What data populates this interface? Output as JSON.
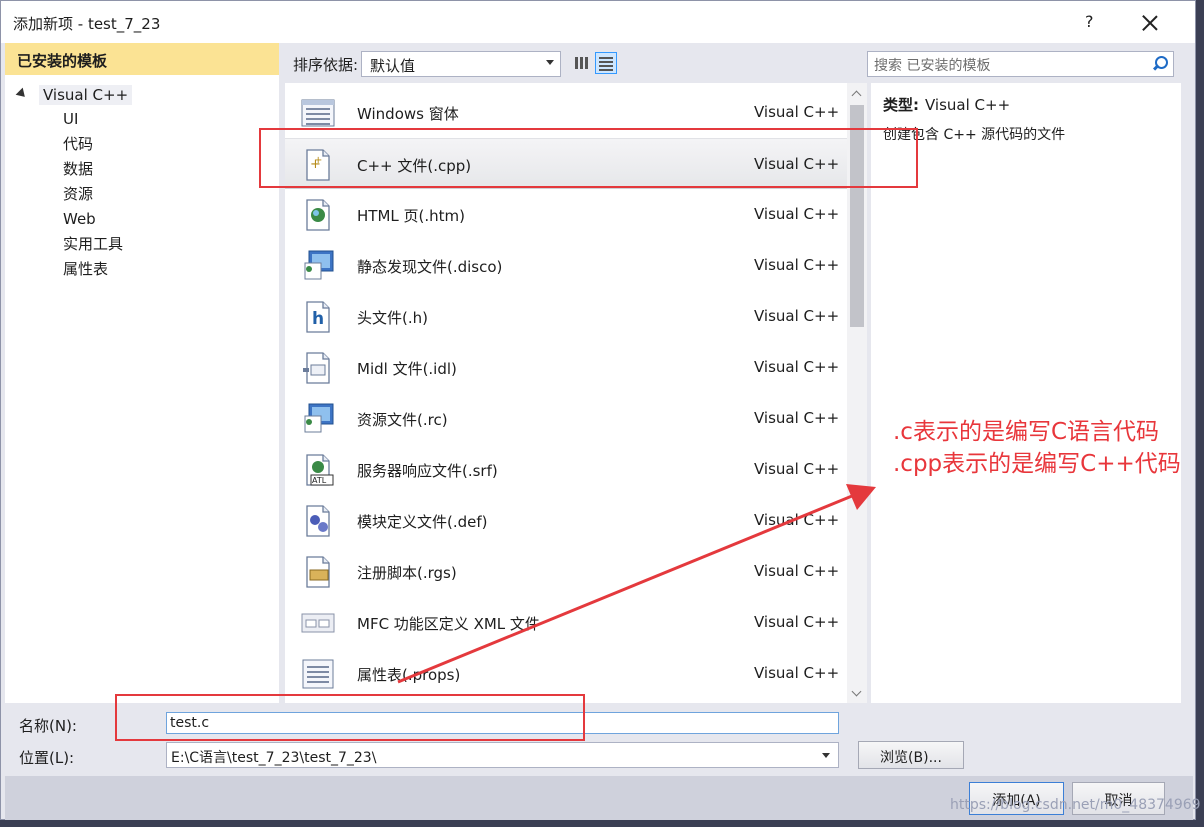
{
  "dialog": {
    "title": "添加新项 - test_7_23",
    "help_label": "?"
  },
  "left": {
    "header": "已安装的模板",
    "root": "Visual C++",
    "children": [
      "UI",
      "代码",
      "数据",
      "资源",
      "Web",
      "实用工具",
      "属性表"
    ]
  },
  "toolbar": {
    "sort_label": "排序依据:",
    "sort_value": "默认值",
    "search_placeholder": "搜索 已安装的模板"
  },
  "templates": [
    {
      "name": "Windows 窗体",
      "lang": "Visual C++",
      "icon": "form-icon"
    },
    {
      "name": "C++ 文件(.cpp)",
      "lang": "Visual C++",
      "icon": "cpp-file-icon",
      "selected": true
    },
    {
      "name": "HTML 页(.htm)",
      "lang": "Visual C++",
      "icon": "html-page-icon"
    },
    {
      "name": "静态发现文件(.disco)",
      "lang": "Visual C++",
      "icon": "disco-file-icon"
    },
    {
      "name": "头文件(.h)",
      "lang": "Visual C++",
      "icon": "header-file-icon"
    },
    {
      "name": "Midl 文件(.idl)",
      "lang": "Visual C++",
      "icon": "idl-file-icon"
    },
    {
      "name": "资源文件(.rc)",
      "lang": "Visual C++",
      "icon": "resource-file-icon"
    },
    {
      "name": "服务器响应文件(.srf)",
      "lang": "Visual C++",
      "icon": "srf-file-icon"
    },
    {
      "name": "模块定义文件(.def)",
      "lang": "Visual C++",
      "icon": "def-file-icon"
    },
    {
      "name": "注册脚本(.rgs)",
      "lang": "Visual C++",
      "icon": "rgs-file-icon"
    },
    {
      "name": "MFC 功能区定义 XML 文件",
      "lang": "Visual C++",
      "icon": "ribbon-xml-icon"
    },
    {
      "name": "属性表(.props)",
      "lang": "Visual C++",
      "icon": "props-file-icon"
    }
  ],
  "detail": {
    "type_label": "类型:",
    "type_value": "Visual C++",
    "description": "创建包含 C++ 源代码的文件"
  },
  "form": {
    "name_label": "名称(N):",
    "name_value": "test.c",
    "location_label": "位置(L):",
    "location_value": "E:\\C语言\\test_7_23\\test_7_23\\",
    "browse_label": "浏览(B)...",
    "add_label": "添加(A)",
    "cancel_label": "取消"
  },
  "annotation": {
    "line1": ".c表示的是编写C语言代码",
    "line2": ".cpp表示的是编写C++代码",
    "color": "#e4393d"
  },
  "watermark": "https://blog.csdn.net/m0_48374969"
}
